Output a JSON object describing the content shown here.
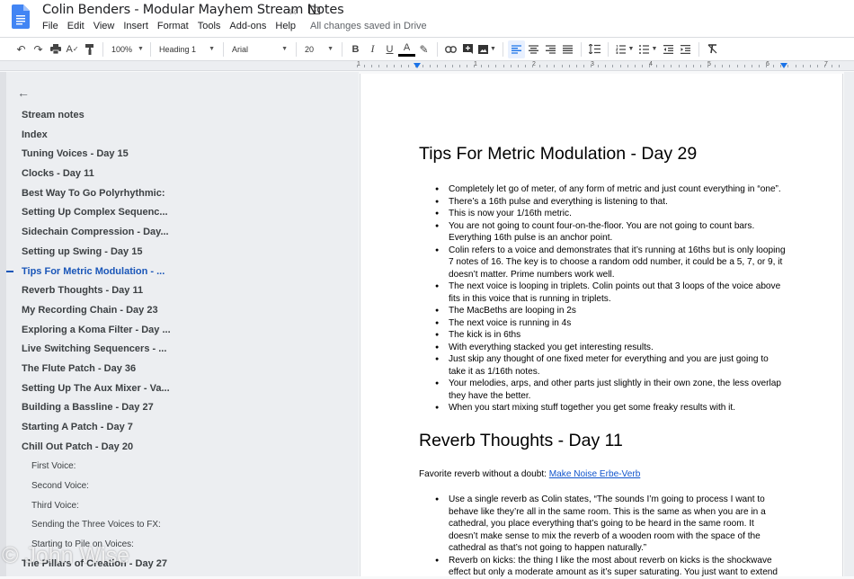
{
  "app": {
    "title": "Colin Benders - Modular Mayhem Stream Notes",
    "save_status": "All changes saved in Drive",
    "icons": {
      "star": "☆",
      "folder": "⊞"
    }
  },
  "menu": [
    "File",
    "Edit",
    "View",
    "Insert",
    "Format",
    "Tools",
    "Add-ons",
    "Help"
  ],
  "toolbar": {
    "zoom": "100%",
    "style": "Heading 1",
    "font": "Arial",
    "font_size": "20",
    "bold": "B",
    "italic": "I",
    "underline": "U",
    "text_color": "A"
  },
  "ruler": {
    "labels": [
      "1",
      "1",
      "2",
      "3",
      "4",
      "5",
      "6",
      "7"
    ]
  },
  "outline": {
    "items": [
      {
        "label": "Stream notes",
        "level": 1
      },
      {
        "label": "Index",
        "level": 1
      },
      {
        "label": "Tuning Voices - Day 15",
        "level": 1
      },
      {
        "label": "Clocks - Day 11",
        "level": 1
      },
      {
        "label": "Best Way To Go Polyrhythmic:",
        "level": 1
      },
      {
        "label": "Setting Up Complex Sequenc...",
        "level": 1
      },
      {
        "label": "Sidechain Compression - Day...",
        "level": 1
      },
      {
        "label": "Setting up Swing - Day 15",
        "level": 1
      },
      {
        "label": "Tips For Metric Modulation - ...",
        "level": 1,
        "active": true
      },
      {
        "label": "Reverb Thoughts - Day 11",
        "level": 1
      },
      {
        "label": "My Recording Chain - Day 23",
        "level": 1
      },
      {
        "label": "Exploring a Koma Filter - Day ...",
        "level": 1
      },
      {
        "label": "Live Switching Sequencers - ...",
        "level": 1
      },
      {
        "label": "The Flute Patch - Day 36",
        "level": 1
      },
      {
        "label": "Setting Up The Aux Mixer - Va...",
        "level": 1
      },
      {
        "label": "Building a Bassline - Day 27",
        "level": 1
      },
      {
        "label": "Starting A Patch - Day 7",
        "level": 1
      },
      {
        "label": "Chill Out Patch - Day 20",
        "level": 1
      },
      {
        "label": "First Voice:",
        "level": 2
      },
      {
        "label": "Second Voice:",
        "level": 2
      },
      {
        "label": "Third Voice:",
        "level": 2
      },
      {
        "label": "Sending the Three Voices to FX:",
        "level": 2
      },
      {
        "label": "Starting to Pile on Voices:",
        "level": 2
      },
      {
        "label": "The Pillars of Creation - Day 27",
        "level": 1
      }
    ]
  },
  "document": {
    "section1": {
      "heading": "Tips For Metric Modulation - Day 29",
      "bullets": [
        "Completely let go of meter, of any form of metric and just count everything in “one”.",
        "There’s a 16th pulse and everything is listening to that.",
        "This is now your 1/16th metric.",
        "You are not going to count four-on-the-floor. You are not going to count bars. Everything 16th pulse is an anchor point.",
        "Colin refers to a voice and demonstrates that it’s running at 16ths but is only looping 7 notes of 16. The key is to choose a random odd number, it could be a 5, 7, or 9, it doesn’t matter. Prime numbers work well.",
        "The next voice is looping in triplets. Colin points out that 3 loops of the voice above fits in this voice that is running in triplets.",
        "The MacBeths are looping in 2s",
        "The next voice is running in 4s",
        "The kick is in 6ths",
        "With everything stacked you get interesting results.",
        "Just skip any thought of one fixed meter for everything and you are just going to take it as 1/16th notes.",
        "Your melodies, arps, and other parts just slightly in their own zone, the less overlap they have the better.",
        "When you start mixing stuff together you get some freaky results with it."
      ]
    },
    "section2": {
      "heading": "Reverb Thoughts - Day 11",
      "intro": "Favorite reverb without a doubt: ",
      "link": "Make Noise Erbe-Verb",
      "bullets": [
        "Use a single reverb as Colin states, “The sounds I’m going to process I want to behave like they’re all in the same room. This is the same as when you are in a cathedral, you place everything that’s going to be heard in the same room. It doesn’t make sense to mix the reverb of a wooden room with the space of the cathedral as that’s not going to happen naturally.”",
        "Reverb on kicks: the thing I like the most about reverb on kicks is the shockwave effect but only a moderate amount as it’s super saturating. You just want to extend"
      ]
    }
  },
  "watermark": "© John Wise",
  "colors": {
    "accent": "#1a73e8",
    "outline_active": "#1a56b8",
    "link": "#1155cc"
  }
}
